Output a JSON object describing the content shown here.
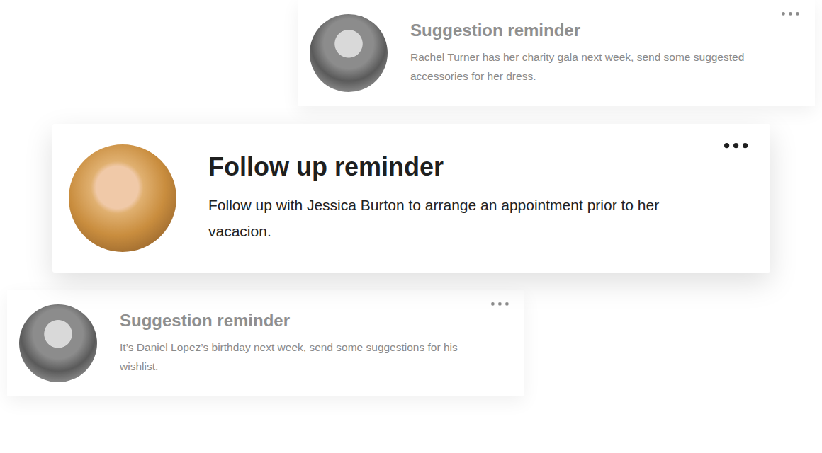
{
  "cards": [
    {
      "title": "Suggestion reminder",
      "text": "Rachel Turner has her charity gala next week, send some suggested accessories for her dress.",
      "selected": false
    },
    {
      "title": "Follow up reminder",
      "text": "Follow up with Jessica Burton to arrange an appointment prior to her vacacion.",
      "selected": true
    },
    {
      "title": "Suggestion reminder",
      "text": "It’s Daniel Lopez’s birthday next week, send some suggestions for his wishlist.",
      "selected": false
    }
  ]
}
